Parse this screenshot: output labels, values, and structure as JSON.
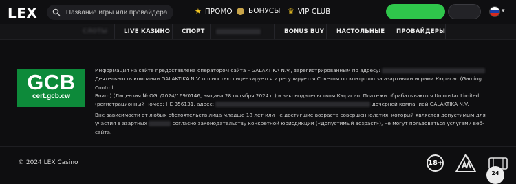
{
  "header": {
    "logo": "LEX",
    "search_placeholder": "Название игры или провайдера",
    "nav": [
      {
        "label": "ПРОМО",
        "icon": "star-icon"
      },
      {
        "label": "БОНУСЫ",
        "icon": "coin-icon"
      },
      {
        "label": "VIP CLUB",
        "icon": "crown-icon"
      }
    ],
    "flag": "ru-flag-icon"
  },
  "subnav": {
    "items": [
      "СЛОТЫ",
      "LIVE КАЗИНО",
      "СПОРТ",
      "",
      "BONUS BUY",
      "НАСТОЛЬНЫЕ",
      "ПРОВАЙДЕРЫ"
    ]
  },
  "license": {
    "logo_big": "GCB",
    "logo_small": "cert.gcb.cw",
    "p1_line1": "Информация на сайте предоставлена оператором сайта – GALAKTIKA N.V., зарегистрированным по адресу:",
    "p1_line2": "Деятельность компании GALAKTIKA N.V. полностью лицензируется и регулируется Советом по контролю за азартными играми Кюрасао (Gaming Control",
    "p1_line3": "Board) (Лицензия № OGL/2024/169/0146, выдана 28 октября 2024 г.) и законодательством Кюрасао. Платежи обрабатываются Unionstar Limited",
    "p1_line4a": "(регистрационный номер: HE 356131, адрес:",
    "p1_line4b": "дочерней компанией GALAKTIKA N.V.",
    "p2_line1": "Вне зависимости от любых обстоятельств лица младше 18 лет или не достигшие возраста совершеннолетия, который является допустимым для",
    "p2_line2a": "участия в азартных",
    "p2_line2b": "согласно законодательству конкретной юрисдикции («Допустимый возраст»), не могут пользоваться услугами веб-сайта."
  },
  "footer": {
    "copyright": "© 2024 LEX Casino",
    "age_badge": "18+",
    "help_badge": "24"
  },
  "colors": {
    "background": "#0e0e10",
    "accent_green": "#2fc64b",
    "gcb_green": "#0d8a3a",
    "gold": "#f3c623"
  }
}
